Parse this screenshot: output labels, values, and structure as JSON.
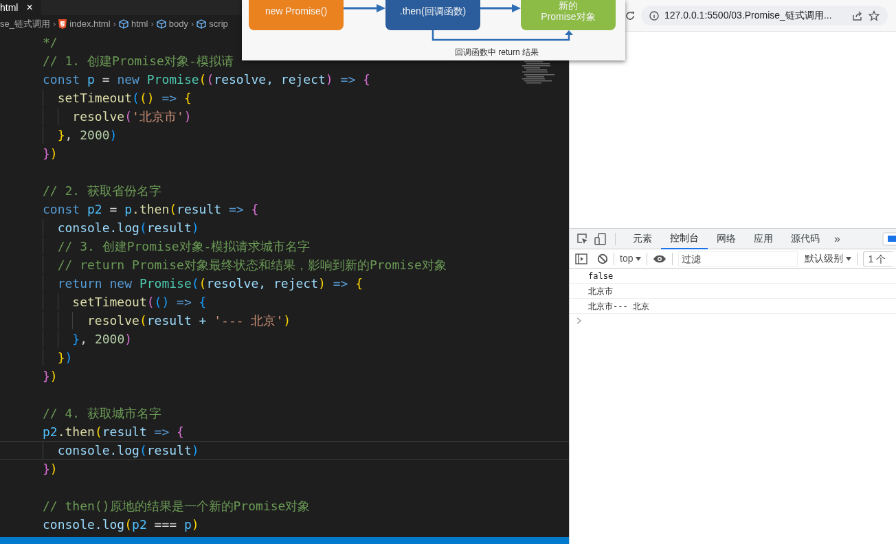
{
  "editor": {
    "tab": {
      "label": "html",
      "close": "×"
    },
    "separator": "›",
    "breadcrumb": [
      {
        "label": "se_链式调用",
        "kind": "folder"
      },
      {
        "label": "index.html",
        "kind": "file"
      },
      {
        "label": "html",
        "kind": "element"
      },
      {
        "label": "body",
        "kind": "element"
      },
      {
        "label": "scrip",
        "kind": "element"
      }
    ],
    "blocks": [
      {
        "lines": [
          {
            "active": false,
            "tokens": [
              {
                "t": "*/",
                "kind": "comment"
              }
            ]
          },
          {
            "active": false,
            "tokens": [
              {
                "t": "// 1. 创建Promise对象-模拟请",
                "kind": "comment"
              }
            ]
          },
          {
            "active": false,
            "tokens": [
              {
                "t": "const ",
                "kind": "keyword"
              },
              {
                "t": "p",
                "kind": "constant"
              },
              {
                "t": " = ",
                "kind": "punct"
              },
              {
                "t": "new ",
                "kind": "keyword"
              },
              {
                "t": "Promise",
                "kind": "type"
              },
              {
                "t": "(",
                "kind": "gold"
              },
              {
                "t": "(",
                "kind": "pink"
              },
              {
                "t": "resolve, reject",
                "kind": "param"
              },
              {
                "t": ")",
                "kind": "pink"
              },
              {
                "t": " => ",
                "kind": "keyword"
              },
              {
                "t": "{",
                "kind": "pink"
              }
            ]
          },
          {
            "active": false,
            "tokens": [
              {
                "t": "  setTimeout",
                "kind": "function"
              },
              {
                "t": "(",
                "kind": "blue"
              },
              {
                "t": "()",
                "kind": "gold"
              },
              {
                "t": " => ",
                "kind": "keyword"
              },
              {
                "t": "{",
                "kind": "gold"
              }
            ]
          },
          {
            "active": false,
            "tokens": [
              {
                "t": "    resolve",
                "kind": "function"
              },
              {
                "t": "(",
                "kind": "pink"
              },
              {
                "t": "'北京市'",
                "kind": "string"
              },
              {
                "t": ")",
                "kind": "pink"
              }
            ]
          },
          {
            "active": false,
            "tokens": [
              {
                "t": "  }",
                "kind": "gold"
              },
              {
                "t": ", ",
                "kind": "punct"
              },
              {
                "t": "2000",
                "kind": "number"
              },
              {
                "t": ")",
                "kind": "blue"
              }
            ]
          },
          {
            "active": false,
            "tokens": [
              {
                "t": "}",
                "kind": "pink"
              },
              {
                "t": ")",
                "kind": "gold"
              }
            ]
          }
        ]
      },
      {
        "lines": [
          {
            "active": false,
            "tokens": [
              {
                "t": "// 2. 获取省份名字",
                "kind": "comment"
              }
            ]
          },
          {
            "active": false,
            "tokens": [
              {
                "t": "const ",
                "kind": "keyword"
              },
              {
                "t": "p2",
                "kind": "constant"
              },
              {
                "t": " = ",
                "kind": "punct"
              },
              {
                "t": "p",
                "kind": "constant"
              },
              {
                "t": ".then",
                "kind": "function"
              },
              {
                "t": "(",
                "kind": "gold"
              },
              {
                "t": "result",
                "kind": "param"
              },
              {
                "t": " => ",
                "kind": "keyword"
              },
              {
                "t": "{",
                "kind": "pink"
              }
            ]
          },
          {
            "active": false,
            "tokens": [
              {
                "t": "  console.log",
                "kind": "param"
              },
              {
                "t": "(",
                "kind": "blue"
              },
              {
                "t": "result",
                "kind": "param"
              },
              {
                "t": ")",
                "kind": "blue"
              }
            ]
          },
          {
            "active": false,
            "tokens": [
              {
                "t": "  // 3. 创建Promise对象-模拟请求城市名字",
                "kind": "comment"
              }
            ]
          },
          {
            "active": false,
            "tokens": [
              {
                "t": "  // return Promise对象最终状态和结果，影响到新的Promise对象",
                "kind": "comment"
              }
            ]
          },
          {
            "active": false,
            "tokens": [
              {
                "t": "  return new ",
                "kind": "keyword"
              },
              {
                "t": "Promise",
                "kind": "type"
              },
              {
                "t": "(",
                "kind": "blue"
              },
              {
                "t": "(",
                "kind": "gold"
              },
              {
                "t": "resolve, reject",
                "kind": "param"
              },
              {
                "t": ")",
                "kind": "gold"
              },
              {
                "t": " => ",
                "kind": "keyword"
              },
              {
                "t": "{",
                "kind": "gold"
              }
            ]
          },
          {
            "active": false,
            "tokens": [
              {
                "t": "    setTimeout",
                "kind": "function"
              },
              {
                "t": "(",
                "kind": "pink"
              },
              {
                "t": "()",
                "kind": "blue"
              },
              {
                "t": " => ",
                "kind": "keyword"
              },
              {
                "t": "{",
                "kind": "blue"
              }
            ]
          },
          {
            "active": false,
            "tokens": [
              {
                "t": "      resolve",
                "kind": "function"
              },
              {
                "t": "(",
                "kind": "gold"
              },
              {
                "t": "result + ",
                "kind": "param"
              },
              {
                "t": "'--- 北京'",
                "kind": "string"
              },
              {
                "t": ")",
                "kind": "gold"
              }
            ]
          },
          {
            "active": false,
            "tokens": [
              {
                "t": "    }",
                "kind": "blue"
              },
              {
                "t": ", ",
                "kind": "punct"
              },
              {
                "t": "2000",
                "kind": "number"
              },
              {
                "t": ")",
                "kind": "pink"
              }
            ]
          },
          {
            "active": false,
            "tokens": [
              {
                "t": "  }",
                "kind": "gold"
              },
              {
                "t": ")",
                "kind": "blue"
              }
            ]
          },
          {
            "active": false,
            "tokens": [
              {
                "t": "}",
                "kind": "pink"
              },
              {
                "t": ")",
                "kind": "gold"
              }
            ]
          }
        ]
      },
      {
        "lines": [
          {
            "active": false,
            "tokens": [
              {
                "t": "// 4. 获取城市名字",
                "kind": "comment"
              }
            ]
          },
          {
            "active": false,
            "tokens": [
              {
                "t": "p2",
                "kind": "constant"
              },
              {
                "t": ".then",
                "kind": "function"
              },
              {
                "t": "(",
                "kind": "gold"
              },
              {
                "t": "result",
                "kind": "param"
              },
              {
                "t": " => ",
                "kind": "keyword"
              },
              {
                "t": "{",
                "kind": "pink"
              }
            ]
          },
          {
            "active": true,
            "tokens": [
              {
                "t": "  console.log",
                "kind": "param"
              },
              {
                "t": "(",
                "kind": "blue"
              },
              {
                "t": "result",
                "kind": "param"
              },
              {
                "t": ")",
                "kind": "blue"
              }
            ]
          },
          {
            "active": false,
            "tokens": [
              {
                "t": "}",
                "kind": "pink"
              },
              {
                "t": ")",
                "kind": "gold"
              }
            ]
          }
        ]
      },
      {
        "lines": [
          {
            "active": false,
            "tokens": [
              {
                "t": "// then()原地的结果是一个新的Promise对象",
                "kind": "comment"
              }
            ]
          },
          {
            "active": false,
            "tokens": [
              {
                "t": "console.log",
                "kind": "param"
              },
              {
                "t": "(",
                "kind": "gold"
              },
              {
                "t": "p2",
                "kind": "constant"
              },
              {
                "t": " === ",
                "kind": "punct"
              },
              {
                "t": "p",
                "kind": "constant"
              },
              {
                "t": ")",
                "kind": "gold"
              }
            ]
          }
        ]
      }
    ]
  },
  "diagram": {
    "boxes": [
      {
        "lines": [
          "new Promise()"
        ],
        "color": "#e9821f"
      },
      {
        "lines": [
          ".then(回调函数)"
        ],
        "color": "#2b5d9c"
      },
      {
        "lines": [
          "新的",
          "Promise对象"
        ],
        "color": "#8cbc46"
      }
    ],
    "loop_label": "回调函数中 return 结果"
  },
  "browser": {
    "url": "127.0.0.1:5500/03.Promise_链式调用..."
  },
  "devtools": {
    "tabs": [
      {
        "label": "元素",
        "selected": false
      },
      {
        "label": "控制台",
        "selected": true
      },
      {
        "label": "网络",
        "selected": false
      },
      {
        "label": "应用",
        "selected": false
      },
      {
        "label": "源代码",
        "selected": false
      }
    ],
    "more": "»",
    "context": "top",
    "filter": {
      "placeholder": "过滤"
    },
    "level": "默认级别",
    "issues": "1 个",
    "messages": [
      "false",
      "北京市",
      "北京市--- 北京"
    ]
  }
}
